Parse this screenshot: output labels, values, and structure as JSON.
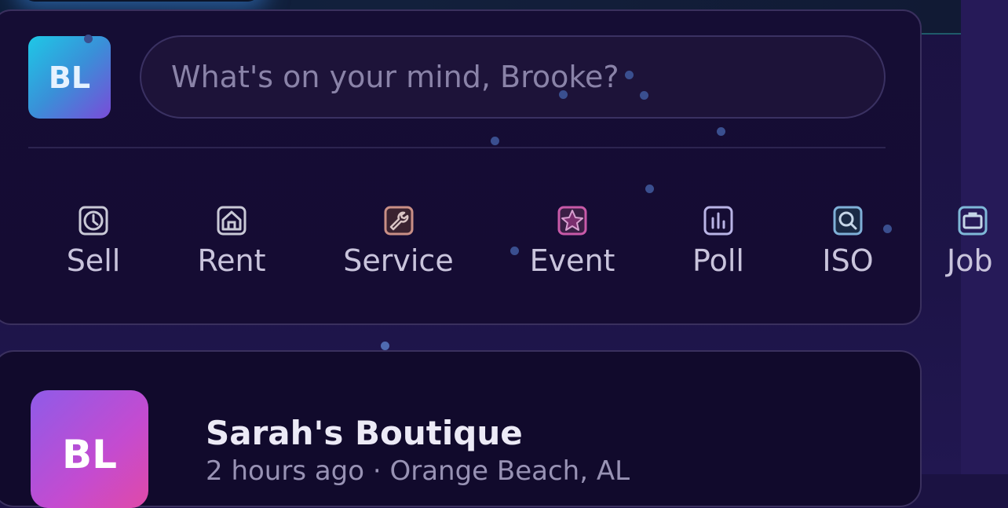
{
  "composer": {
    "avatar_initials": "BL",
    "placeholder": "What's on your mind, Brooke?",
    "actions": [
      {
        "label": "Sell",
        "icon": "clock-icon",
        "color": "#c9c9d6"
      },
      {
        "label": "Rent",
        "icon": "house-icon",
        "color": "#c9c9d6"
      },
      {
        "label": "Service",
        "icon": "wrench-icon",
        "color": "#c98f86"
      },
      {
        "label": "Event",
        "icon": "star-icon",
        "color": "#c85aa8"
      },
      {
        "label": "Poll",
        "icon": "bar-chart-icon",
        "color": "#b9b4e6"
      },
      {
        "label": "ISO",
        "icon": "search-icon",
        "color": "#7fb0d8"
      },
      {
        "label": "Job",
        "icon": "briefcase-icon",
        "color": "#7fb8d8"
      }
    ]
  },
  "post": {
    "avatar_initials": "BL",
    "author": "Sarah's Boutique",
    "meta": "2 hours ago · Orange Beach, AL"
  }
}
